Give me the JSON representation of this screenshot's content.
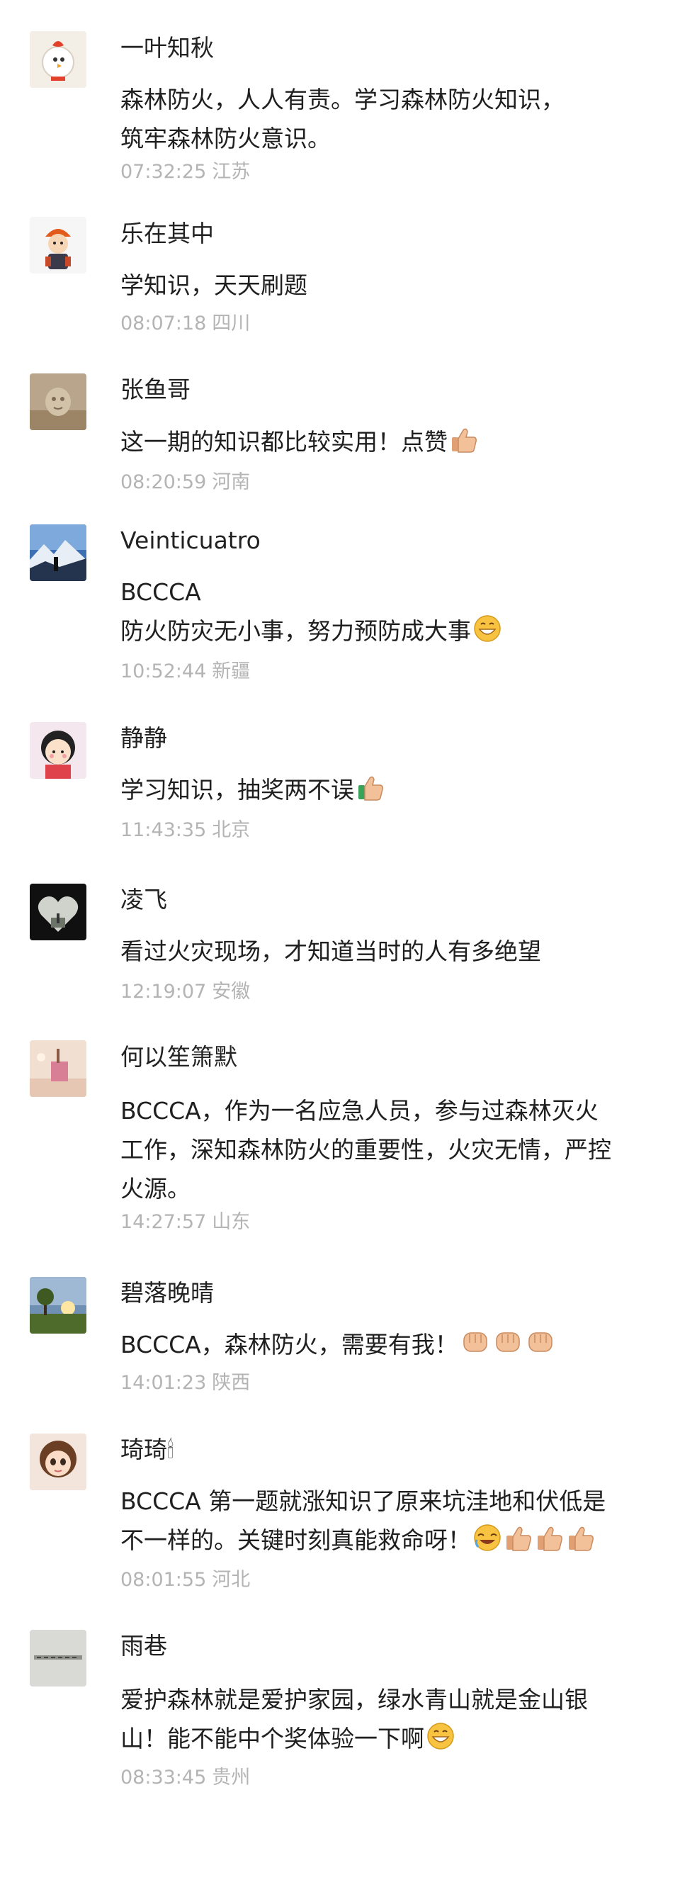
{
  "comments": [
    {
      "user": "一叶知秋",
      "lines": [
        "森林防火，人人有责。学习森林防火知识，",
        "筑牢森林防火意识。"
      ],
      "time": "07:32:25",
      "location": "江苏",
      "avatar_icon": "rooster-cartoon-avatar"
    },
    {
      "user": "乐在其中",
      "lines": [
        "学知识，天天刷题"
      ],
      "time": "08:07:18",
      "location": "四川",
      "avatar_icon": "cartoon-character-avatar"
    },
    {
      "user": "张鱼哥",
      "lines": [
        "这一期的知识都比较实用！点赞"
      ],
      "line_emojis": [
        [
          "thumbs-up"
        ]
      ],
      "time": "08:20:59",
      "location": "河南",
      "avatar_icon": "sand-sculpture-avatar"
    },
    {
      "user": "Veinticuatro",
      "lines": [
        "BCCCA",
        "防火防灾无小事，努力预防成大事"
      ],
      "line_emojis": [
        [],
        [
          "grin-emoji"
        ]
      ],
      "time": "10:52:44",
      "location": "新疆",
      "avatar_icon": "mountain-sky-avatar"
    },
    {
      "user": "静静",
      "lines": [
        "学习知识，抽奖两不误"
      ],
      "line_emojis": [
        [
          "thumbs-up-green"
        ]
      ],
      "time": "11:43:35",
      "location": "北京",
      "avatar_icon": "girl-cartoon-avatar"
    },
    {
      "user": "凌飞",
      "lines": [
        "看过火灾现场，才知道当时的人有多绝望"
      ],
      "time": "12:19:07",
      "location": "安徽",
      "avatar_icon": "heart-silhouette-avatar"
    },
    {
      "user": "何以笙箫默",
      "lines": [
        "BCCCA，作为一名应急人员，参与过森林灭火",
        "工作，深知森林防火的重要性，火灾无情，严控",
        "火源。"
      ],
      "time": "14:27:57",
      "location": "山东",
      "avatar_icon": "pink-room-avatar"
    },
    {
      "user": "碧落晚晴",
      "lines": [
        "BCCCA，森林防火，需要有我！"
      ],
      "line_emojis": [
        [
          "fist",
          "fist",
          "fist"
        ]
      ],
      "time": "14:01:23",
      "location": "陕西",
      "avatar_icon": "sunset-tree-avatar"
    },
    {
      "user": "琦琦🕯",
      "lines": [
        "BCCCA 第一题就涨知识了原来坑洼地和伏低是",
        "不一样的。关键时刻真能救命呀！"
      ],
      "line_emojis": [
        [],
        [
          "rolling-laugh",
          "thumbs-up",
          "thumbs-up",
          "thumbs-up"
        ]
      ],
      "time": "08:01:55",
      "location": "河北",
      "avatar_icon": "doll-girl-avatar"
    },
    {
      "user": "雨巷",
      "lines": [
        "爱护森林就是爱护家园，绿水青山就是金山银",
        "山！能不能中个奖体验一下啊"
      ],
      "line_emojis": [
        [],
        [
          "grin-emoji"
        ]
      ],
      "time": "08:33:45",
      "location": "贵州",
      "avatar_icon": "calligraphy-avatar"
    }
  ]
}
